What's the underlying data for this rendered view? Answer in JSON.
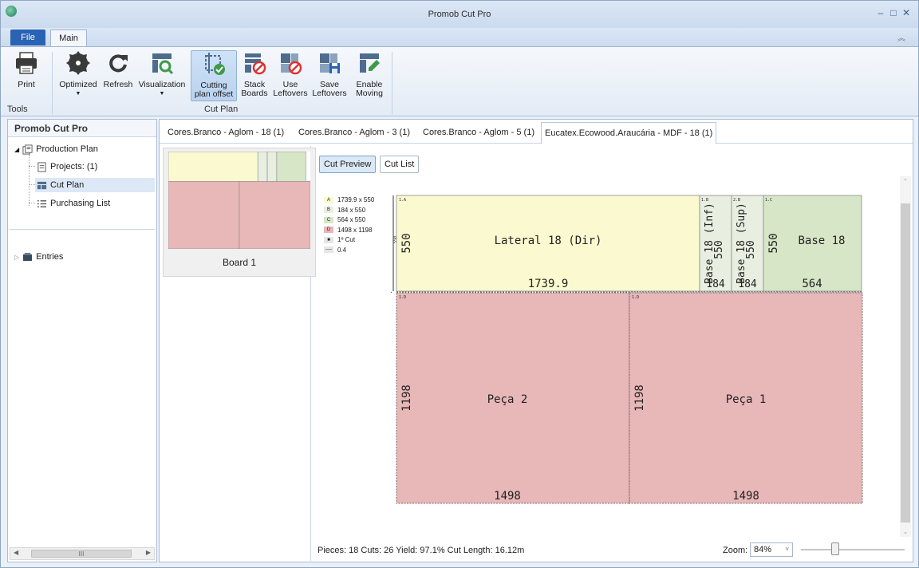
{
  "window": {
    "title": "Promob Cut Pro"
  },
  "ribbon": {
    "tabs": {
      "file": "File",
      "main": "Main"
    },
    "buttons": {
      "print": "Print",
      "optimized": "Optimized",
      "refresh": "Refresh",
      "visualization": "Visualization",
      "cutting_offset_1": "Cutting",
      "cutting_offset_2": "plan offset",
      "stack_1": "Stack",
      "stack_2": "Boards",
      "use_1": "Use",
      "use_2": "Leftovers",
      "save_1": "Save",
      "save_2": "Leftovers",
      "enable_1": "Enable",
      "enable_2": "Moving"
    },
    "groups": {
      "tools": "Tools",
      "cut_plan": "Cut Plan"
    }
  },
  "left_panel": {
    "header": "Promob Cut Pro",
    "tree": {
      "production_plan": "Production Plan",
      "projects": "Projects: (1)",
      "cut_plan": "Cut Plan",
      "purchasing_list": "Purchasing List",
      "entries": "Entries"
    },
    "scroll_thumb": "III"
  },
  "doc_tabs": [
    "Cores.Branco - Aglom - 18 (1)",
    "Cores.Branco - Aglom - 3 (1)",
    "Cores.Branco - Aglom - 5 (1)",
    "Eucatex.Ecowood.Araucária - MDF - 18 (1)"
  ],
  "boards": {
    "board1": "Board 1"
  },
  "viewer": {
    "cut_preview": "Cut Preview",
    "cut_list": "Cut List"
  },
  "legend": [
    {
      "code": "A",
      "size": "1739.9 x 550",
      "color": "#fbf9cf"
    },
    {
      "code": "B",
      "size": "184 x 550",
      "color": "#e8eee0"
    },
    {
      "code": "C",
      "size": "564 x 550",
      "color": "#d6e6c7"
    },
    {
      "code": "D",
      "size": "1498 x 1198",
      "color": "#e8b7b8"
    },
    {
      "code": "1º Cut"
    },
    {
      "code": "0.4"
    }
  ],
  "pieces": {
    "A": {
      "tag": "1.A",
      "name": "Lateral 18 (Dir)",
      "w": "1739.9",
      "h": "550",
      "color": "#fbf9cf"
    },
    "B1": {
      "tag": "1.B",
      "name": "Base 18 (Inf)",
      "w": "184",
      "h": "550",
      "color": "#e8eee0"
    },
    "B2": {
      "tag": "2.B",
      "name": "Base 18 (Sup)",
      "w": "184",
      "h": "550",
      "color": "#e8eee0"
    },
    "C": {
      "tag": "1.C",
      "name": "Base 18",
      "w": "564",
      "h": "550",
      "color": "#d6e6c7"
    },
    "D1": {
      "tag": "1.D",
      "name": "Peça 2",
      "w": "1498",
      "h": "1198",
      "color": "#e8b7b8"
    },
    "D2": {
      "tag": "1.D",
      "name": "Peça 1",
      "w": "1498",
      "h": "1198",
      "color": "#e8b7b8"
    }
  },
  "board_height_label": "550",
  "status": {
    "stats": "Pieces: 18   Cuts: 26   Yield: 97.1%   Cut Length: 16.12m",
    "zoom_label": "Zoom:",
    "zoom_value": "84%",
    "zoom_fraction": 0.33
  }
}
